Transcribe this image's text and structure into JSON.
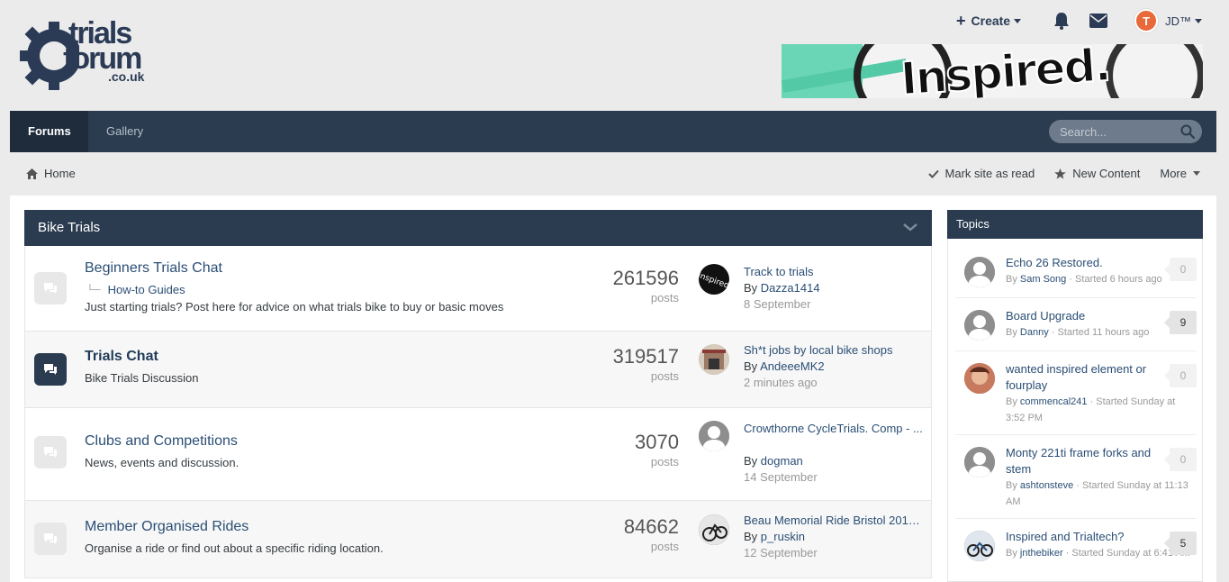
{
  "site": {
    "logo_line1": "trials",
    "logo_line2": "forum",
    "logo_line3": ".co.uk",
    "banner_text": "Inspired."
  },
  "userbar": {
    "create_label": "Create",
    "username": "JD™",
    "avatar_letter": "T"
  },
  "nav": {
    "tabs": [
      {
        "label": "Forums"
      },
      {
        "label": "Gallery"
      }
    ],
    "search_placeholder": "Search..."
  },
  "breadcrumb": {
    "home": "Home",
    "mark_read": "Mark site as read",
    "new_content": "New Content",
    "more": "More"
  },
  "category": {
    "title": "Bike Trials",
    "forums": [
      {
        "title": "Beginners Trials Chat",
        "subforum": "How-to Guides",
        "description": "Just starting trials? Post here for advice on what trials bike to buy or basic moves",
        "count": "261596",
        "count_label": "posts",
        "last_topic": "Track to trials",
        "last_by_prefix": "By",
        "last_by": "Dazza1414",
        "last_date": "8 September"
      },
      {
        "title": "Trials Chat",
        "description": "Bike Trials Discussion",
        "count": "319517",
        "count_label": "posts",
        "last_topic": "Sh*t jobs by local bike shops",
        "last_by_prefix": "By",
        "last_by": "AndeeeMK2",
        "last_date": "2 minutes ago"
      },
      {
        "title": "Clubs and Competitions",
        "description": "News, events and discussion.",
        "count": "3070",
        "count_label": "posts",
        "last_topic": "Crowthorne CycleTrials. Comp - ...",
        "last_by_prefix": "By",
        "last_by": "dogman",
        "last_date": "14 September"
      },
      {
        "title": "Member Organised Rides",
        "description": "Organise a ride or find out about a specific riding location.",
        "count": "84662",
        "count_label": "posts",
        "last_topic": "Beau Memorial Ride Bristol 201…",
        "last_by_prefix": "By",
        "last_by": "p_ruskin",
        "last_date": "12 September"
      }
    ]
  },
  "sidebar": {
    "title": "Topics",
    "topics": [
      {
        "title": "Echo 26 Restored.",
        "by_prefix": "By",
        "by": "Sam Song",
        "started": " · Started 6 hours ago",
        "count": "0"
      },
      {
        "title": "Board Upgrade",
        "by_prefix": "By",
        "by": "Danny",
        "started": " · Started 11 hours ago",
        "count": "9"
      },
      {
        "title": "wanted inspired element or fourplay",
        "by_prefix": "By",
        "by": "commencal241",
        "started": " · Started Sunday at 3:52 PM",
        "count": "0"
      },
      {
        "title": "Monty 221ti frame forks and stem",
        "by_prefix": "By",
        "by": "ashtonsteve",
        "started": " · Started Sunday at 11:13 AM",
        "count": "0"
      },
      {
        "title": "Inspired and Trialtech?",
        "by_prefix": "By",
        "by": "jnthebiker",
        "started": " · Started Sunday at 6:41 AM",
        "count": "5"
      }
    ]
  }
}
